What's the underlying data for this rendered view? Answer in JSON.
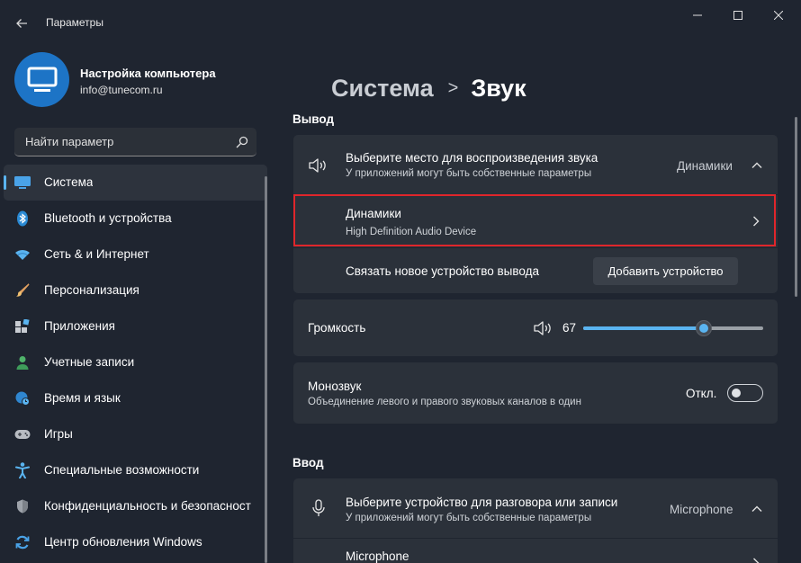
{
  "window": {
    "title": "Параметры",
    "back_icon": "arrow-left-icon",
    "controls": [
      "minimize-icon",
      "maximize-icon",
      "close-icon"
    ]
  },
  "profile": {
    "name": "Настройка компьютера",
    "email": "info@tunecom.ru",
    "avatar_icon": "monitor-icon"
  },
  "search": {
    "placeholder": "Найти параметр",
    "icon": "search-icon"
  },
  "sidebar": {
    "items": [
      {
        "label": "Система",
        "icon": "system-icon",
        "active": true
      },
      {
        "label": "Bluetooth и устройства",
        "icon": "bluetooth-icon"
      },
      {
        "label": "Сеть & и Интернет",
        "icon": "wifi-icon"
      },
      {
        "label": "Персонализация",
        "icon": "brush-icon"
      },
      {
        "label": "Приложения",
        "icon": "apps-icon"
      },
      {
        "label": "Учетные записи",
        "icon": "person-icon"
      },
      {
        "label": "Время и язык",
        "icon": "globe-clock-icon"
      },
      {
        "label": "Игры",
        "icon": "gamepad-icon"
      },
      {
        "label": "Специальные возможности",
        "icon": "accessibility-icon"
      },
      {
        "label": "Конфиденциальность и безопасность",
        "icon": "shield-icon"
      },
      {
        "label": "Центр обновления Windows",
        "icon": "update-icon"
      }
    ]
  },
  "breadcrumb": {
    "parent": "Система",
    "separator": ">",
    "current": "Звук"
  },
  "output": {
    "section_title": "Вывод",
    "select_device": {
      "title": "Выберите место для воспроизведения звука",
      "subtitle": "У приложений могут быть собственные параметры",
      "value": "Динамики"
    },
    "device": {
      "title": "Динамики",
      "subtitle": "High Definition Audio Device"
    },
    "pair": {
      "title": "Связать новое устройство вывода",
      "button": "Добавить устройство"
    },
    "volume": {
      "title": "Громкость",
      "value": "67",
      "level": 67
    },
    "mono": {
      "title": "Монозвук",
      "subtitle": "Объединение левого и правого звуковых каналов в один",
      "state": "Откл."
    }
  },
  "input": {
    "section_title": "Ввод",
    "select_device": {
      "title": "Выберите устройство для разговора или записи",
      "subtitle": "У приложений могут быть собственные параметры",
      "value": "Microphone"
    },
    "device": {
      "title": "Microphone"
    }
  },
  "colors": {
    "accent": "#5ab4f0",
    "highlight_border": "#e0262b",
    "window_bg": "#1f2530",
    "card_bg": "#2b313a"
  }
}
